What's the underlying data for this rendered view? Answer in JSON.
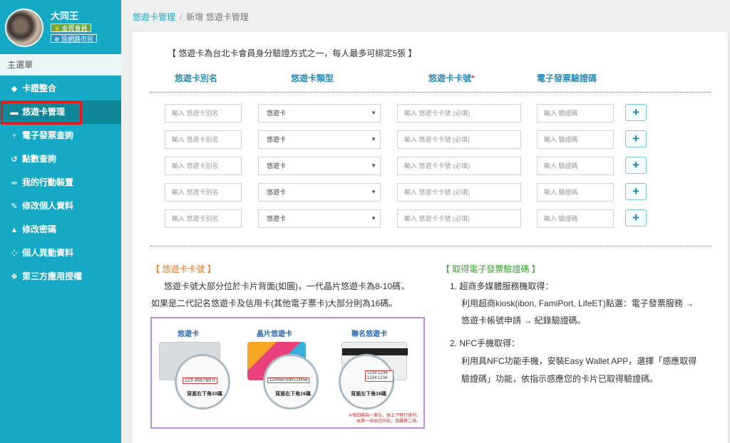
{
  "sidebar": {
    "user_name": "大同王",
    "badge_membership": "金質會員",
    "badge_city": "原網路市民",
    "menu_header": "主選單",
    "items": [
      {
        "label": "卡證整合",
        "icon": "tag-icon"
      },
      {
        "label": "悠遊卡管理",
        "icon": "card-icon",
        "active": true
      },
      {
        "label": "電子發票查詢",
        "icon": "trophy-icon"
      },
      {
        "label": "點數查詢",
        "icon": "history-icon"
      },
      {
        "label": "我的行動裝置",
        "icon": "link-icon"
      },
      {
        "label": "修改個人資料",
        "icon": "edit-icon"
      },
      {
        "label": "修改密碼",
        "icon": "unlock-icon"
      },
      {
        "label": "個人異動資料",
        "icon": "spinner-icon"
      },
      {
        "label": "第三方應用授權",
        "icon": "cubes-icon"
      }
    ]
  },
  "breadcrumb": {
    "root": "悠遊卡管理",
    "separator": "/",
    "current": "新增 悠遊卡管理"
  },
  "form": {
    "notice": "【 悠遊卡為台北卡會員身分驗證方式之一，每人最多可綁定5張 】",
    "headers": {
      "alias": "悠遊卡別名",
      "type": "悠遊卡類型",
      "number": "悠遊卡卡號",
      "required_mark": "*",
      "invoice": "電子發票驗證碼"
    },
    "rows": [
      {
        "alias_placeholder": "輸入 悠遊卡別名",
        "type_value": "悠遊卡",
        "number_placeholder": "輸入 悠遊卡卡號 (必填)",
        "invoice_placeholder": "輸入 驗證碼",
        "add_label": "+"
      },
      {
        "alias_placeholder": "輸入 悠遊卡別名",
        "type_value": "悠遊卡",
        "number_placeholder": "輸入 悠遊卡卡號 (必填)",
        "invoice_placeholder": "輸入 驗證碼",
        "add_label": "+"
      },
      {
        "alias_placeholder": "輸入 悠遊卡別名",
        "type_value": "悠遊卡",
        "number_placeholder": "輸入 悠遊卡卡號 (必填)",
        "invoice_placeholder": "輸入 驗證碼",
        "add_label": "+"
      },
      {
        "alias_placeholder": "輸入 悠遊卡別名",
        "type_value": "悠遊卡",
        "number_placeholder": "輸入 悠遊卡卡號 (必填)",
        "invoice_placeholder": "輸入 驗證碼",
        "add_label": "+"
      },
      {
        "alias_placeholder": "輸入 悠遊卡別名",
        "type_value": "悠遊卡",
        "number_placeholder": "輸入 悠遊卡卡號 (必填)",
        "invoice_placeholder": "輸入 驗證碼",
        "add_label": "+"
      }
    ]
  },
  "card_info": {
    "title": "【 悠遊卡卡號 】",
    "line1": "悠遊卡號大部分位於卡片背面(如圖)，一代晶片悠遊卡為8-10碼，",
    "line2": "如果是二代記名悠遊卡及信用卡(其他電子票卡)大部分則為16碼。",
    "image": {
      "titles": [
        "悠遊卡",
        "晶片悠遊卡",
        "聯名悠遊卡"
      ],
      "numbers": [
        "123 456789 0",
        "1234567890123456",
        "1234 1234 1234 1234"
      ],
      "captions": [
        "背面右下角10碼",
        "背面右下角16碼",
        "背面左下角16碼"
      ],
      "footnote_1": "※每四碼為一單位，採上下兩行排列，",
      "footnote_2": "由第一排由左向右，接續第二排。"
    }
  },
  "invoice_info": {
    "title": "【 取得電子發票驗證碼 】",
    "step1_title": "1. 超商多媒體服務機取得：",
    "step1_line1": "利用超商kiosk(ibon, FamiPort, LifeET)點選：電子發票服務 →",
    "step1_line2": "悠遊卡帳號申請 → 紀錄驗證碼。",
    "step2_title": "2. NFC手機取得：",
    "step2_line1": "利用具NFC功能手機，安裝Easy Wallet APP，選擇「感應取得",
    "step2_line2": "驗證碼」功能，依指示感應您的卡片已取得驗證碼。"
  },
  "colors": {
    "sidebar": "#16a9c5",
    "active_item": "#0f8798",
    "highlight_box": "#e31b1b",
    "header_text": "#2e8ab3",
    "orange_title": "#e6741a",
    "green_title": "#3e9b36"
  }
}
